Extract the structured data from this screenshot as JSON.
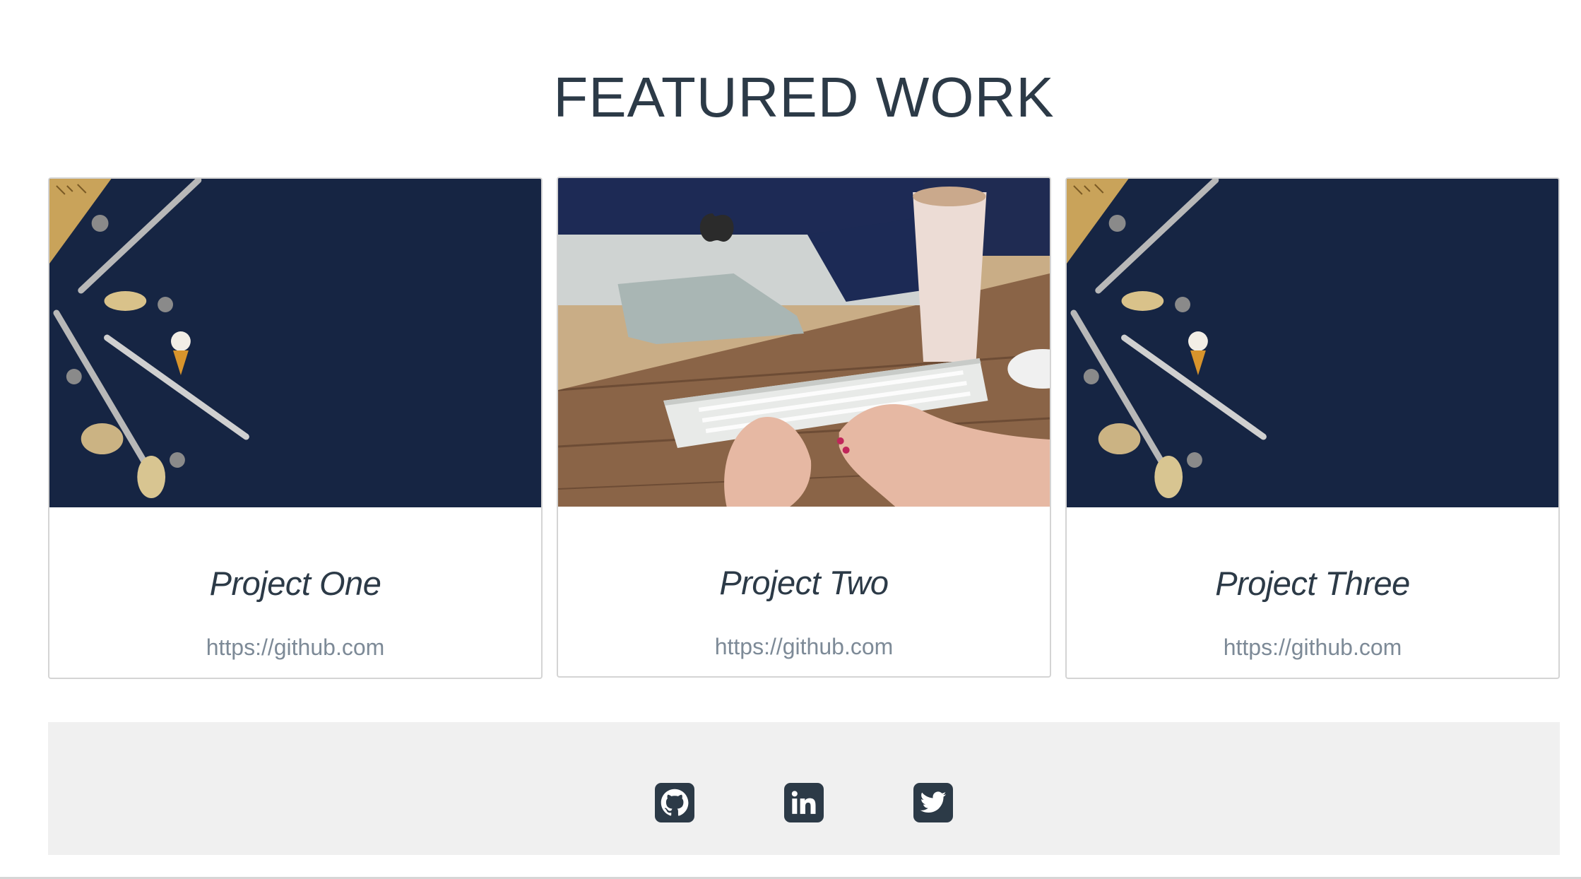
{
  "featured": {
    "title": "FEATURED WORK",
    "projects": [
      {
        "title": "Project One",
        "link": "https://github.com",
        "image": "desk-stationery-photo"
      },
      {
        "title": "Project Two",
        "link": "https://github.com",
        "image": "typing-keyboard-photo"
      },
      {
        "title": "Project Three",
        "link": "https://github.com",
        "image": "desk-stationery-photo"
      }
    ]
  },
  "footer": {
    "social": [
      {
        "name": "GitHub",
        "icon": "github-icon"
      },
      {
        "name": "LinkedIn",
        "icon": "linkedin-icon"
      },
      {
        "name": "Twitter",
        "icon": "twitter-icon"
      }
    ]
  },
  "colors": {
    "heading": "#2c3a47",
    "link": "#7d8a97",
    "footer_bg": "#f0f0f0",
    "icon_bg": "#2c3a47"
  }
}
